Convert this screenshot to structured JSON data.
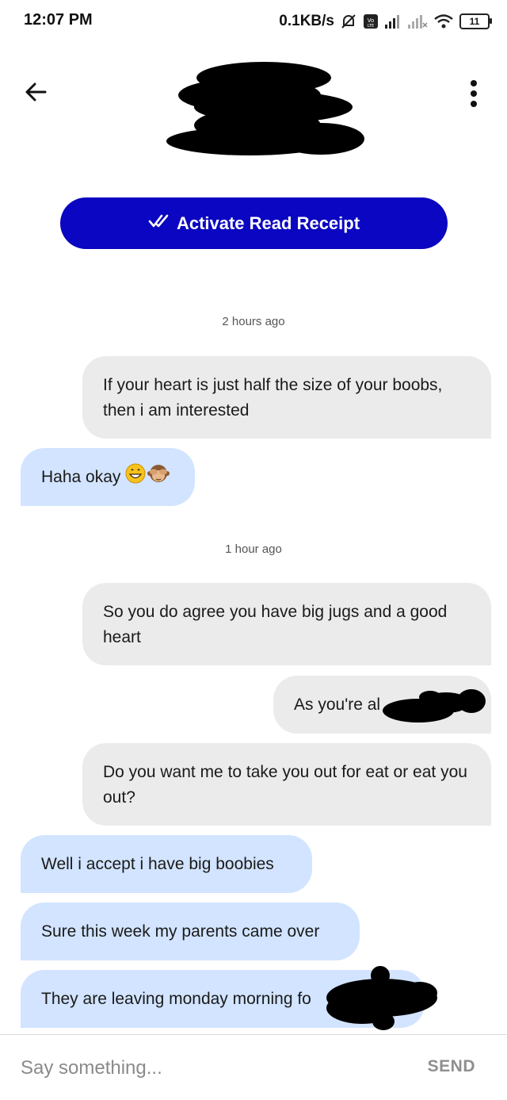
{
  "status_bar": {
    "time": "12:07 PM",
    "net_speed": "0.1KB/s",
    "battery": "11"
  },
  "header": {
    "back_icon": "arrow-left-icon",
    "menu_icon": "more-vertical-icon"
  },
  "read_receipt": {
    "label": "Activate Read Receipt",
    "icon": "double-check-icon",
    "color": "#0b06c1"
  },
  "messages": {
    "timestamp_1": "2 hours ago",
    "m1": "If your heart is just half the size of your boobs, then i am interested",
    "m2": "Haha okay",
    "timestamp_2": "1 hour ago",
    "m3": "So you do agree you have big jugs and a good heart",
    "m4": "As you're al",
    "m5": "Do you want me to take you out for eat or eat you out?",
    "m6": "Well i accept i have big boobies",
    "m7": "Sure this week my parents came over",
    "m8": "They are leaving monday morning fo"
  },
  "composer": {
    "placeholder": "Say something...",
    "send_label": "SEND"
  },
  "colors": {
    "sent_bubble": "#ebebeb",
    "received_bubble": "#d2e4ff"
  }
}
